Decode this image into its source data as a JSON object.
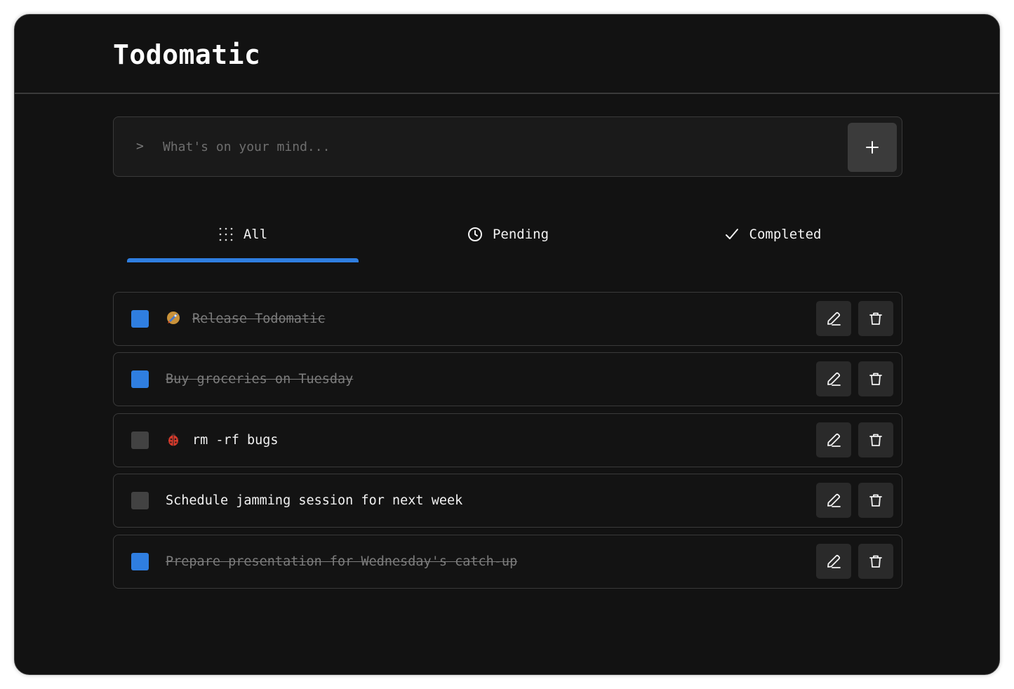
{
  "app": {
    "title": "Todomatic"
  },
  "new_task": {
    "prompt_symbol": ">",
    "placeholder": "What's on your mind...",
    "value": "",
    "add_icon": "plus-icon"
  },
  "tabs": [
    {
      "label": "All",
      "icon": "grid-dots-icon",
      "active": true
    },
    {
      "label": "Pending",
      "icon": "clock-icon",
      "active": false
    },
    {
      "label": "Completed",
      "icon": "checkmark-icon",
      "active": false
    }
  ],
  "tasks": [
    {
      "text": "Release Todomatic",
      "emoji": "rocket",
      "completed": true
    },
    {
      "text": "Buy groceries on Tuesday",
      "emoji": "",
      "completed": true
    },
    {
      "text": "rm -rf bugs",
      "emoji": "ladybug",
      "completed": false
    },
    {
      "text": "Schedule jamming session for next week",
      "emoji": "",
      "completed": false
    },
    {
      "text": "Prepare presentation for Wednesday's catch-up",
      "emoji": "",
      "completed": true
    }
  ],
  "colors": {
    "accent": "#2f7ee0",
    "background": "#121212",
    "unchecked": "#424242",
    "button_bg": "#2a2a2a"
  }
}
